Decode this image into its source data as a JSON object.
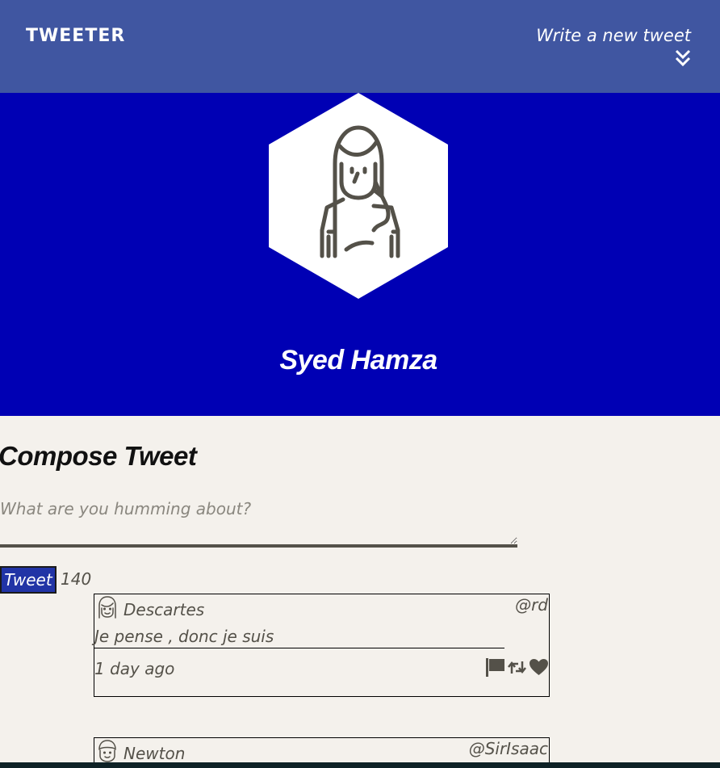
{
  "nav": {
    "brand": "TWEETER",
    "write_label": "Write a new tweet",
    "chevron_icon": "double-chevron-down-icon"
  },
  "profile": {
    "name": "Syed Hamza",
    "avatar_icon": "user-avatar-icon"
  },
  "compose": {
    "title": "Compose Tweet",
    "placeholder": "What are you humming about?",
    "button_label": "Tweet",
    "counter": "140"
  },
  "tweets": [
    {
      "name": "Descartes",
      "handle": "@rd",
      "text": "Je pense , donc je suis",
      "time": "1 day ago",
      "actions": [
        "flag-icon",
        "retweet-icon",
        "heart-icon"
      ]
    },
    {
      "name": "Newton",
      "handle": "@SirIsaac"
    }
  ],
  "colors": {
    "nav": "#4056a1",
    "header": "#0000b4",
    "background": "#f4f1ec",
    "button": "#2134a6",
    "text": "#545149"
  }
}
